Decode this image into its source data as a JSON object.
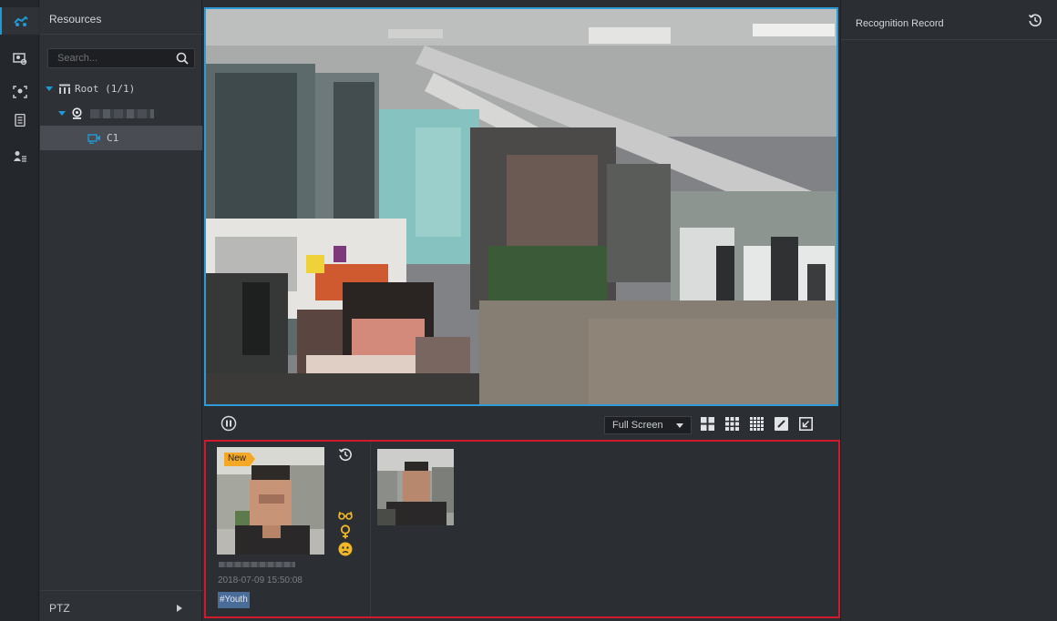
{
  "rail": {
    "items": [
      {
        "icon": "live-view-icon",
        "active": true
      },
      {
        "icon": "face-search-icon"
      },
      {
        "icon": "face-capture-icon"
      },
      {
        "icon": "report-icon"
      },
      {
        "icon": "person-list-icon"
      }
    ]
  },
  "resources": {
    "title": "Resources",
    "search_placeholder": "Search...",
    "tree": {
      "root_label": "Root (1/1)",
      "channel_label": "C1"
    },
    "ptz_label": "PTZ"
  },
  "toolbar": {
    "fullscreen_label": "Full Screen",
    "layout_icons": [
      "layout-2x2-icon",
      "layout-3x3-icon",
      "layout-4x4-icon",
      "edit-layout-icon",
      "exit-window-icon"
    ]
  },
  "snapshots": {
    "new_badge": "New",
    "time": "2018-07-09 15:50:08",
    "tag": "#Youth",
    "attribute_icons": [
      "glasses-icon",
      "female-icon",
      "expression-icon"
    ]
  },
  "record": {
    "title": "Recognition Record"
  },
  "colors": {
    "accent": "#1e9bd7",
    "selection_border": "#d0192b",
    "video_border": "#2e9bd6",
    "badge": "#f3a826",
    "attribute": "#f3b827"
  }
}
